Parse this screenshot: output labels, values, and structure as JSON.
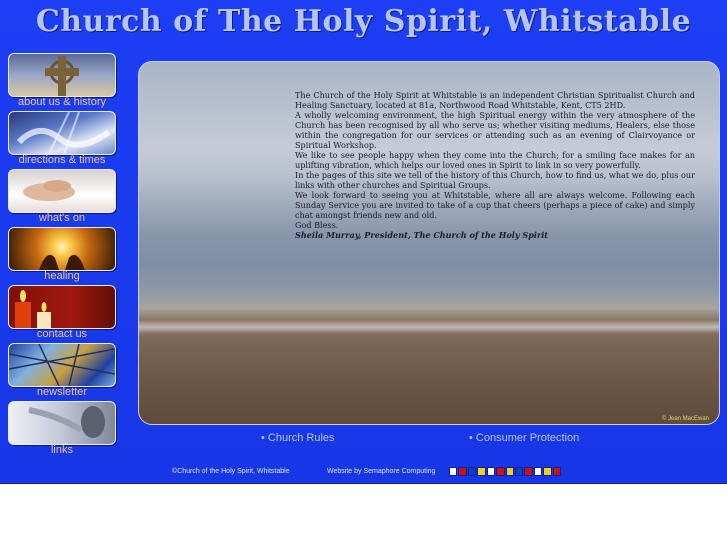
{
  "header": {
    "title": "Church of The Holy Spirit, Whitstable"
  },
  "nav": {
    "items": [
      {
        "label": "about us & history",
        "icon": "celtic-cross-icon",
        "colors": [
          "#3a4a6a",
          "#8a95b8",
          "#d8c8a0"
        ]
      },
      {
        "label": "directions & times",
        "icon": "sunbeam-clouds-icon",
        "colors": [
          "#2a3a7a",
          "#e0e6f4",
          "#5a78c8"
        ]
      },
      {
        "label": "what's on",
        "icon": "praying-hands-icon",
        "colors": [
          "#c8c0c0",
          "#e6d0c0",
          "#ffffff"
        ]
      },
      {
        "label": "healing",
        "icon": "healing-hands-icon",
        "colors": [
          "#c86a10",
          "#f8c040",
          "#301808"
        ]
      },
      {
        "label": "contact us",
        "icon": "candles-icon",
        "colors": [
          "#801008",
          "#e04010",
          "#f8e060"
        ]
      },
      {
        "label": "newsletter",
        "icon": "stained-glass-icon",
        "colors": [
          "#2040a0",
          "#c8a040",
          "#80b0e0"
        ]
      },
      {
        "label": "links",
        "icon": "angel-statue-icon",
        "colors": [
          "#c0c8d8",
          "#6a7080",
          "#f0f0f4"
        ]
      }
    ]
  },
  "main": {
    "paragraphs": [
      "The Church of the Holy Spirit at Whitstable is an independent Christian Spiritualist Church and Healing Sanctuary, located at 81a, Northwood Road Whitstable, Kent, CT5 2HD.",
      "A wholly welcoming environment, the high Spiritual energy within the very atmosphere of the Church has been recognised by all who serve us; whether visiting mediums, Healers, else those within the congregation for our services or attending such as an evening of Clairvoyance or Spiritual Workshop.",
      "We like to see people happy when they come into the Church; for a smiling face makes for an uplifting vibration, which helps our loved ones in Spirit to link in so very powerfully.",
      "In the pages of this site we tell of the history of this Church, how to find us, what we do, plus our links with other churches and Spiritual Groups.",
      "We look forward to seeing you at Whitstable, where all are always welcome. Following each Sunday Service you are invited to take of a cup that cheers (perhaps a piece of cake) and simply chat amongst friends new and old.",
      "God Bless."
    ],
    "signature": "Sheila Murray, President, The Church of the Holy Spirit",
    "photo_credit": "© Jean MacEwan"
  },
  "links": {
    "church_rules": "• Church Rules",
    "consumer_protection": "• Consumer Protection"
  },
  "footer": {
    "copyright": "©Church of the Holy Spirit, Whitstable",
    "credit": "Website by Semaphore Computing",
    "flag_colors": [
      "#ffffff",
      "#d01010",
      "#1040c0",
      "#f0d020",
      "#ffffff",
      "#d01010",
      "#f0d020",
      "#1040c0",
      "#d01010",
      "#ffffff",
      "#f0d020",
      "#d01010"
    ]
  }
}
